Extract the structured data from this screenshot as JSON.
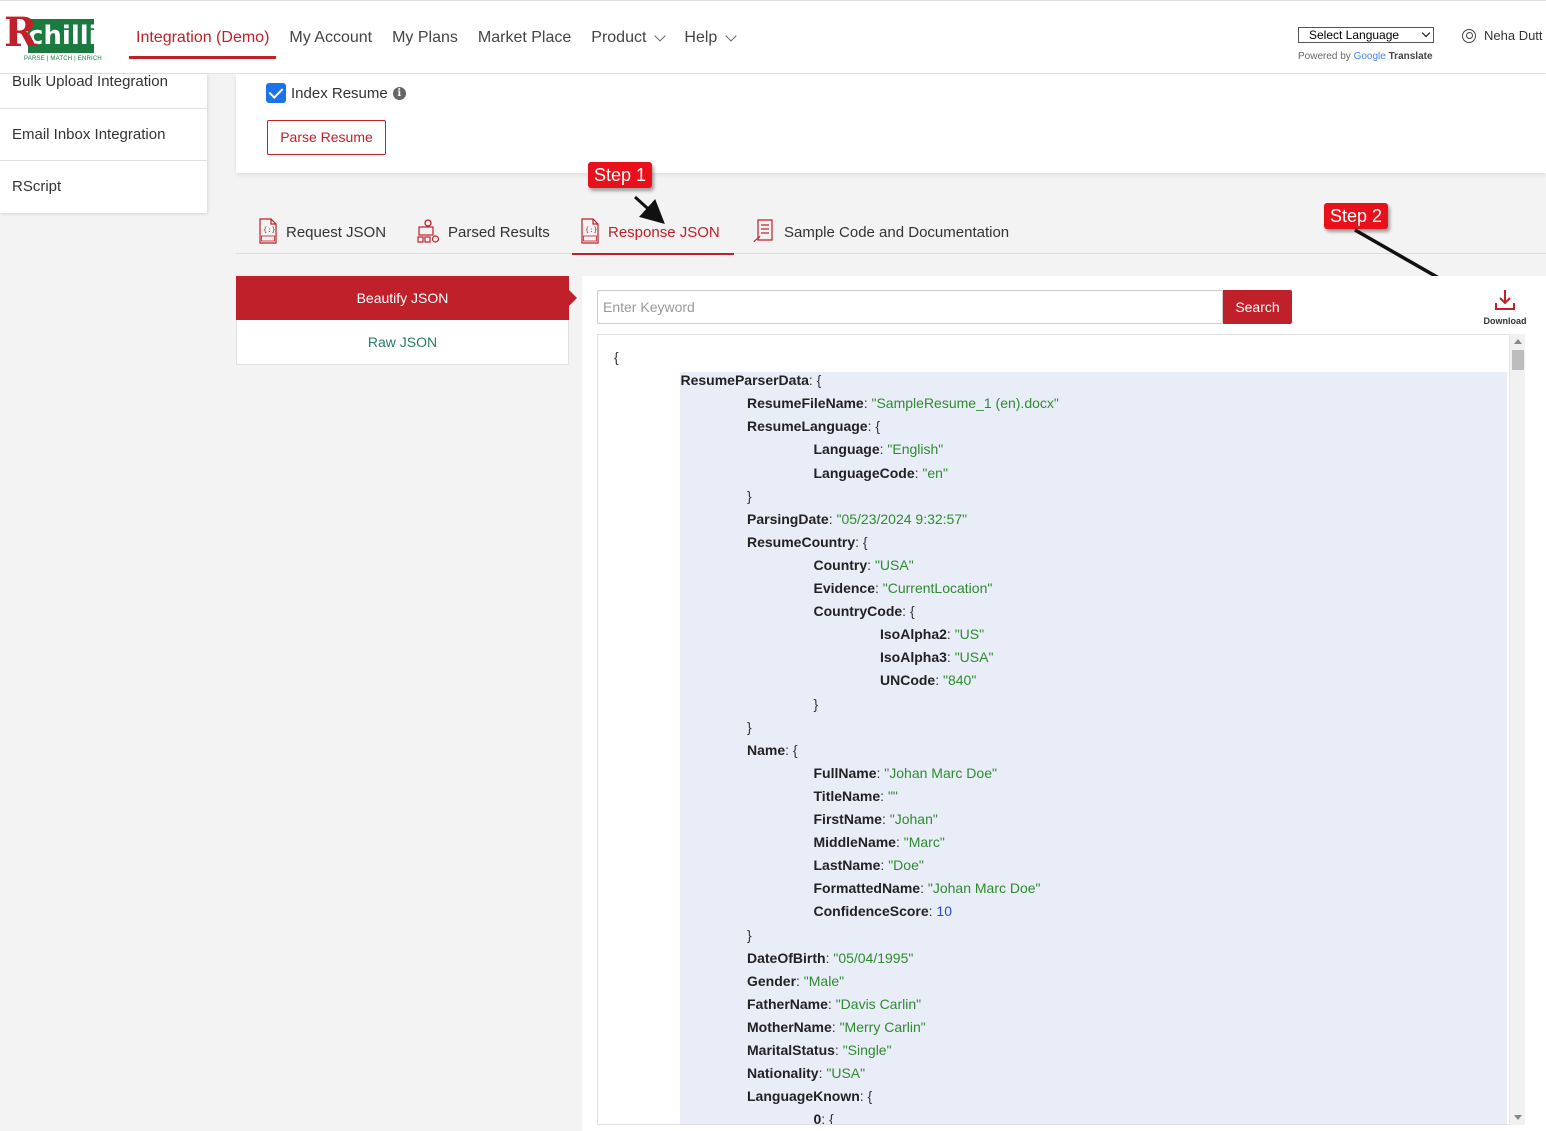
{
  "header": {
    "logo_letter": "R",
    "logo_word": "chilli",
    "logo_tagline": "PARSE | MATCH | ENRICH",
    "nav": [
      {
        "label": "Integration (Demo)",
        "active": true
      },
      {
        "label": "My Account"
      },
      {
        "label": "My Plans"
      },
      {
        "label": "Market Place"
      },
      {
        "label": "Product",
        "dropdown": true
      },
      {
        "label": "Help",
        "dropdown": true
      }
    ],
    "language_select": "Select Language",
    "powered_by": "Powered by",
    "google": "Google",
    "translate": "Translate",
    "user_name": "Neha Dutt"
  },
  "sidebar": {
    "items": [
      "Bulk Upload Integration",
      "Email Inbox Integration",
      "RScript"
    ]
  },
  "top_panel": {
    "index_resume_label": "Index Resume",
    "index_resume_checked": true,
    "parse_button": "Parse Resume"
  },
  "tabs": [
    {
      "label": "Request JSON",
      "icon": "json-file-icon"
    },
    {
      "label": "Parsed Results",
      "icon": "parsed-results-icon"
    },
    {
      "label": "Response JSON",
      "icon": "json-file-icon",
      "active": true
    },
    {
      "label": "Sample Code and Documentation",
      "icon": "documentation-icon"
    }
  ],
  "annotations": {
    "step1": "Step 1",
    "step2": "Step 2"
  },
  "format_panel": {
    "beautify": "Beautify JSON",
    "raw": "Raw JSON"
  },
  "json_panel": {
    "search_placeholder": "Enter Keyword",
    "search_button": "Search",
    "download_label": "Download",
    "lines": [
      {
        "indent": 0,
        "punct": "{"
      },
      {
        "indent": 1,
        "key": "ResumeParserData",
        "punct": ": {"
      },
      {
        "indent": 2,
        "key": "ResumeFileName",
        "sep": ": ",
        "str": "\"SampleResume_1 (en).docx\""
      },
      {
        "indent": 2,
        "key": "ResumeLanguage",
        "punct": ": {"
      },
      {
        "indent": 3,
        "key": "Language",
        "sep": ": ",
        "str": "\"English\""
      },
      {
        "indent": 3,
        "key": "LanguageCode",
        "sep": ": ",
        "str": "\"en\""
      },
      {
        "indent": 2,
        "punct": "}"
      },
      {
        "indent": 2,
        "key": "ParsingDate",
        "sep": ": ",
        "str": "\"05/23/2024 9:32:57\""
      },
      {
        "indent": 2,
        "key": "ResumeCountry",
        "punct": ": {"
      },
      {
        "indent": 3,
        "key": "Country",
        "sep": ": ",
        "str": "\"USA\""
      },
      {
        "indent": 3,
        "key": "Evidence",
        "sep": ": ",
        "str": "\"CurrentLocation\""
      },
      {
        "indent": 3,
        "key": "CountryCode",
        "punct": ": {"
      },
      {
        "indent": 4,
        "key": "IsoAlpha2",
        "sep": ": ",
        "str": "\"US\""
      },
      {
        "indent": 4,
        "key": "IsoAlpha3",
        "sep": ": ",
        "str": "\"USA\""
      },
      {
        "indent": 4,
        "key": "UNCode",
        "sep": ": ",
        "str": "\"840\""
      },
      {
        "indent": 3,
        "punct": "}"
      },
      {
        "indent": 2,
        "punct": "}"
      },
      {
        "indent": 2,
        "key": "Name",
        "punct": ": {"
      },
      {
        "indent": 3,
        "key": "FullName",
        "sep": ": ",
        "str": "\"Johan Marc Doe\""
      },
      {
        "indent": 3,
        "key": "TitleName",
        "sep": ": ",
        "str": "\"\""
      },
      {
        "indent": 3,
        "key": "FirstName",
        "sep": ": ",
        "str": "\"Johan\""
      },
      {
        "indent": 3,
        "key": "MiddleName",
        "sep": ": ",
        "str": "\"Marc\""
      },
      {
        "indent": 3,
        "key": "LastName",
        "sep": ": ",
        "str": "\"Doe\""
      },
      {
        "indent": 3,
        "key": "FormattedName",
        "sep": ": ",
        "str": "\"Johan Marc Doe\""
      },
      {
        "indent": 3,
        "key": "ConfidenceScore",
        "sep": ": ",
        "num": "10"
      },
      {
        "indent": 2,
        "punct": "}"
      },
      {
        "indent": 2,
        "key": "DateOfBirth",
        "sep": ": ",
        "str": "\"05/04/1995\""
      },
      {
        "indent": 2,
        "key": "Gender",
        "sep": ": ",
        "str": "\"Male\""
      },
      {
        "indent": 2,
        "key": "FatherName",
        "sep": ": ",
        "str": "\"Davis Carlin\""
      },
      {
        "indent": 2,
        "key": "MotherName",
        "sep": ": ",
        "str": "\"Merry Carlin\""
      },
      {
        "indent": 2,
        "key": "MaritalStatus",
        "sep": ": ",
        "str": "\"Single\""
      },
      {
        "indent": 2,
        "key": "Nationality",
        "sep": ": ",
        "str": "\"USA\""
      },
      {
        "indent": 2,
        "key": "LanguageKnown",
        "punct": ": {"
      },
      {
        "indent": 3,
        "key": "0",
        "punct": ": {"
      }
    ]
  },
  "colors": {
    "brand_red": "#c0202a",
    "step_red": "#e8111b",
    "logo_green": "#1b7b3f",
    "json_string": "#2e8b2e",
    "json_number": "#2a4ad8",
    "json_highlight": "#e9edf8"
  }
}
